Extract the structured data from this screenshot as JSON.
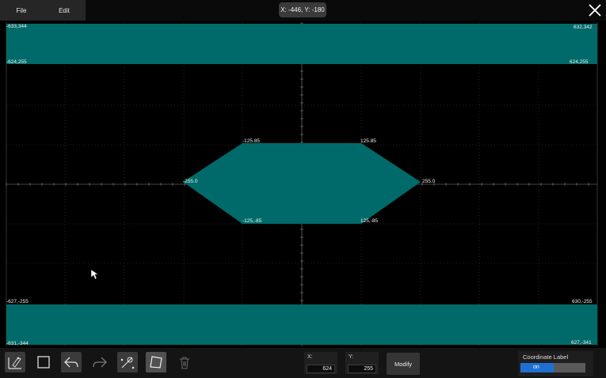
{
  "menu": {
    "file": "File",
    "edit": "Edit"
  },
  "cursor_readout": "X: -446, Y: -180",
  "close_icon": "close-icon",
  "plot": {
    "top_band": {
      "top_left": "-633,344",
      "top_right": "632,342",
      "bottom_left": "-624,255",
      "bottom_right": "624,255"
    },
    "bottom_band": {
      "top_left": "-627,-255",
      "top_right": "630,-255",
      "bottom_left": "-631,-344",
      "bottom_right": "627,-341"
    },
    "hexagon": {
      "top_left": "-125.85",
      "top_right": "125.85",
      "left": "-255.0",
      "right": "255.0",
      "bottom_left": "-125,-85",
      "bottom_right": "125,-85"
    },
    "fill_color": "#006a6a"
  },
  "toolbar": {
    "tools": [
      "pen-tool-icon",
      "rectangle-icon",
      "undo-icon",
      "redo-icon",
      "node-edit-icon",
      "polygon-icon",
      "trash-icon"
    ],
    "x_label": "X:",
    "x_value": "624",
    "y_label": "Y:",
    "y_value": "255",
    "modify_label": "Modify",
    "coord_label_title": "Coordinate Label",
    "coord_label_state": "on"
  }
}
